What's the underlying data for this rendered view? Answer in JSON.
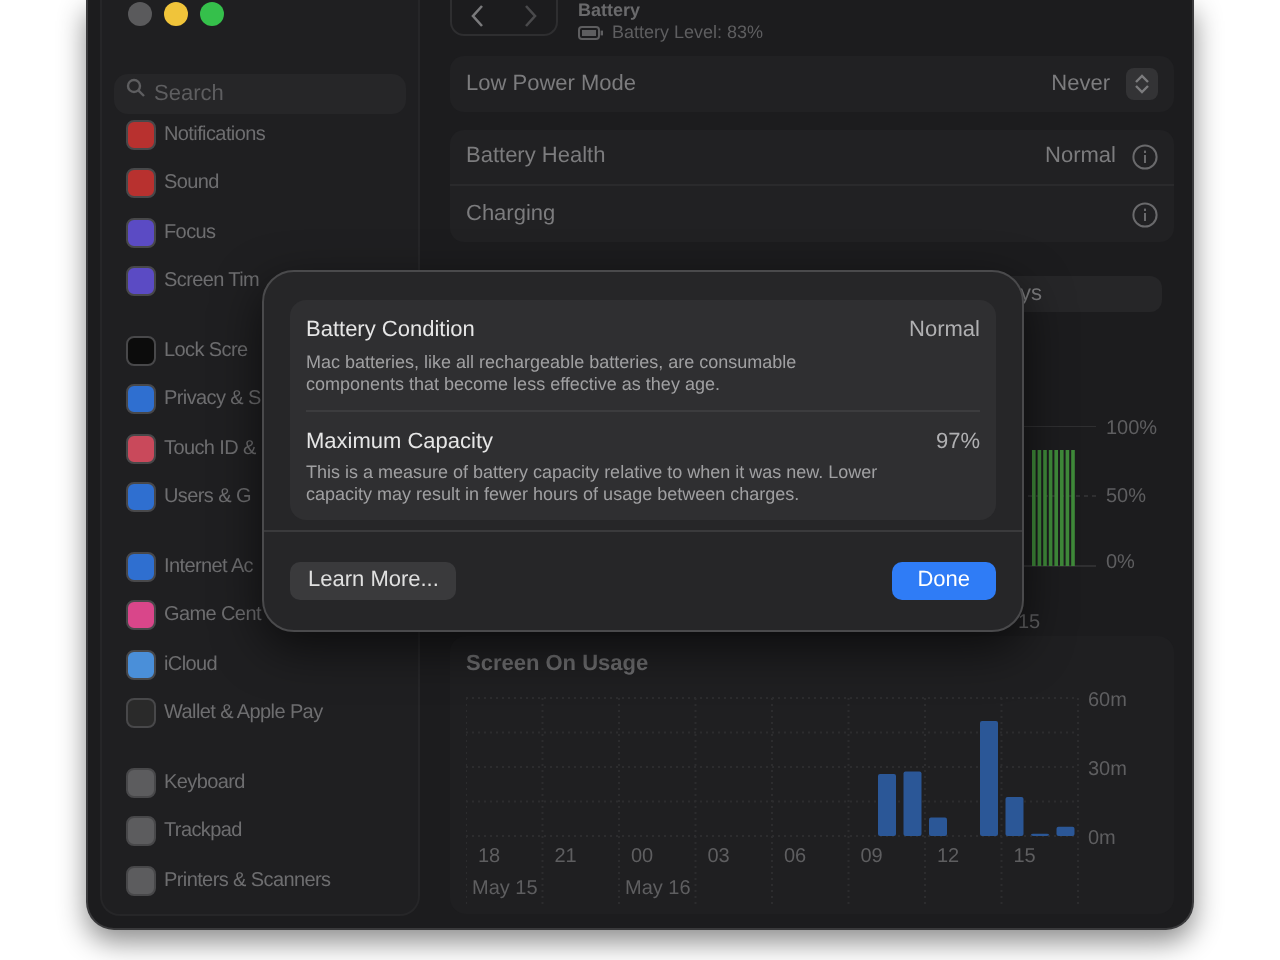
{
  "sidebar": {
    "search": {
      "placeholder": "Search"
    },
    "groups": [
      [
        {
          "label": "Notifications",
          "color": "#b8312f"
        },
        {
          "label": "Sound",
          "color": "#b8312f"
        },
        {
          "label": "Focus",
          "color": "#5b4bc4"
        },
        {
          "label": "Screen Tim",
          "color": "#5b4bc4"
        }
      ],
      [
        {
          "label": "Lock Scre",
          "color": "#0c0c0c"
        },
        {
          "label": "Privacy & S",
          "color": "#2f6fd0"
        },
        {
          "label": "Touch ID &",
          "color": "#c9495b"
        },
        {
          "label": "Users & G",
          "color": "#2f6fd0"
        }
      ],
      [
        {
          "label": "Internet Ac",
          "color": "#2f6fd0"
        },
        {
          "label": "Game Cent",
          "color": "#d9468a"
        },
        {
          "label": "iCloud",
          "color": "#4a8fd9"
        },
        {
          "label": "Wallet & Apple Pay",
          "color": "#2a2a2a"
        }
      ],
      [
        {
          "label": "Keyboard",
          "color": "#5c5c5e"
        },
        {
          "label": "Trackpad",
          "color": "#5c5c5e"
        },
        {
          "label": "Printers & Scanners",
          "color": "#5c5c5e"
        }
      ]
    ]
  },
  "header": {
    "title": "Battery",
    "subtitle": "Battery Level: 83%"
  },
  "settings": [
    [
      {
        "label": "Low Power Mode",
        "value": "Never",
        "kind": "popup"
      }
    ],
    [
      {
        "label": "Battery Health",
        "value": "Normal",
        "kind": "info"
      },
      {
        "label": "Charging",
        "kind": "info"
      }
    ]
  ],
  "range_tab": {
    "label": "ys"
  },
  "battery_chart": {
    "yticks": [
      "100%",
      "50%",
      "0%"
    ],
    "xtick": "15"
  },
  "usage": {
    "title": "Screen On Usage",
    "chart_data": {
      "type": "bar",
      "categories": [
        "18",
        null,
        null,
        "21",
        null,
        null,
        "00",
        null,
        null,
        "03",
        null,
        null,
        "06",
        null,
        null,
        "09",
        null,
        null,
        "12",
        null,
        null,
        "15",
        null,
        null
      ],
      "grid": true,
      "series": [
        {
          "color": "#2b5797",
          "values": [
            0,
            0,
            0,
            0,
            0,
            0,
            0,
            0,
            0,
            0,
            0,
            0,
            0,
            0,
            0,
            0,
            27,
            28,
            8,
            0,
            50,
            17,
            1,
            4
          ]
        }
      ],
      "ylim": [
        0,
        60
      ],
      "yticks": [
        {
          "value": 0,
          "label": "0m"
        },
        {
          "value": 30,
          "label": "30m"
        },
        {
          "value": 60,
          "label": "60m"
        }
      ],
      "annotations": [
        "May 15",
        "May 16"
      ]
    }
  },
  "sheet": {
    "rows": [
      {
        "title": "Battery Condition",
        "value": "Normal",
        "text": "Mac batteries, like all rechargeable batteries, are consumable components that become less effective as they age."
      },
      {
        "title": "Maximum Capacity",
        "value": "97%",
        "text": "This is a measure of battery capacity relative to when it was new. Lower capacity may result in fewer hours of usage between charges."
      }
    ],
    "buttons": [
      {
        "label": "Learn More...",
        "kind": "secondary"
      },
      {
        "label": "Done",
        "kind": "primary"
      }
    ]
  }
}
